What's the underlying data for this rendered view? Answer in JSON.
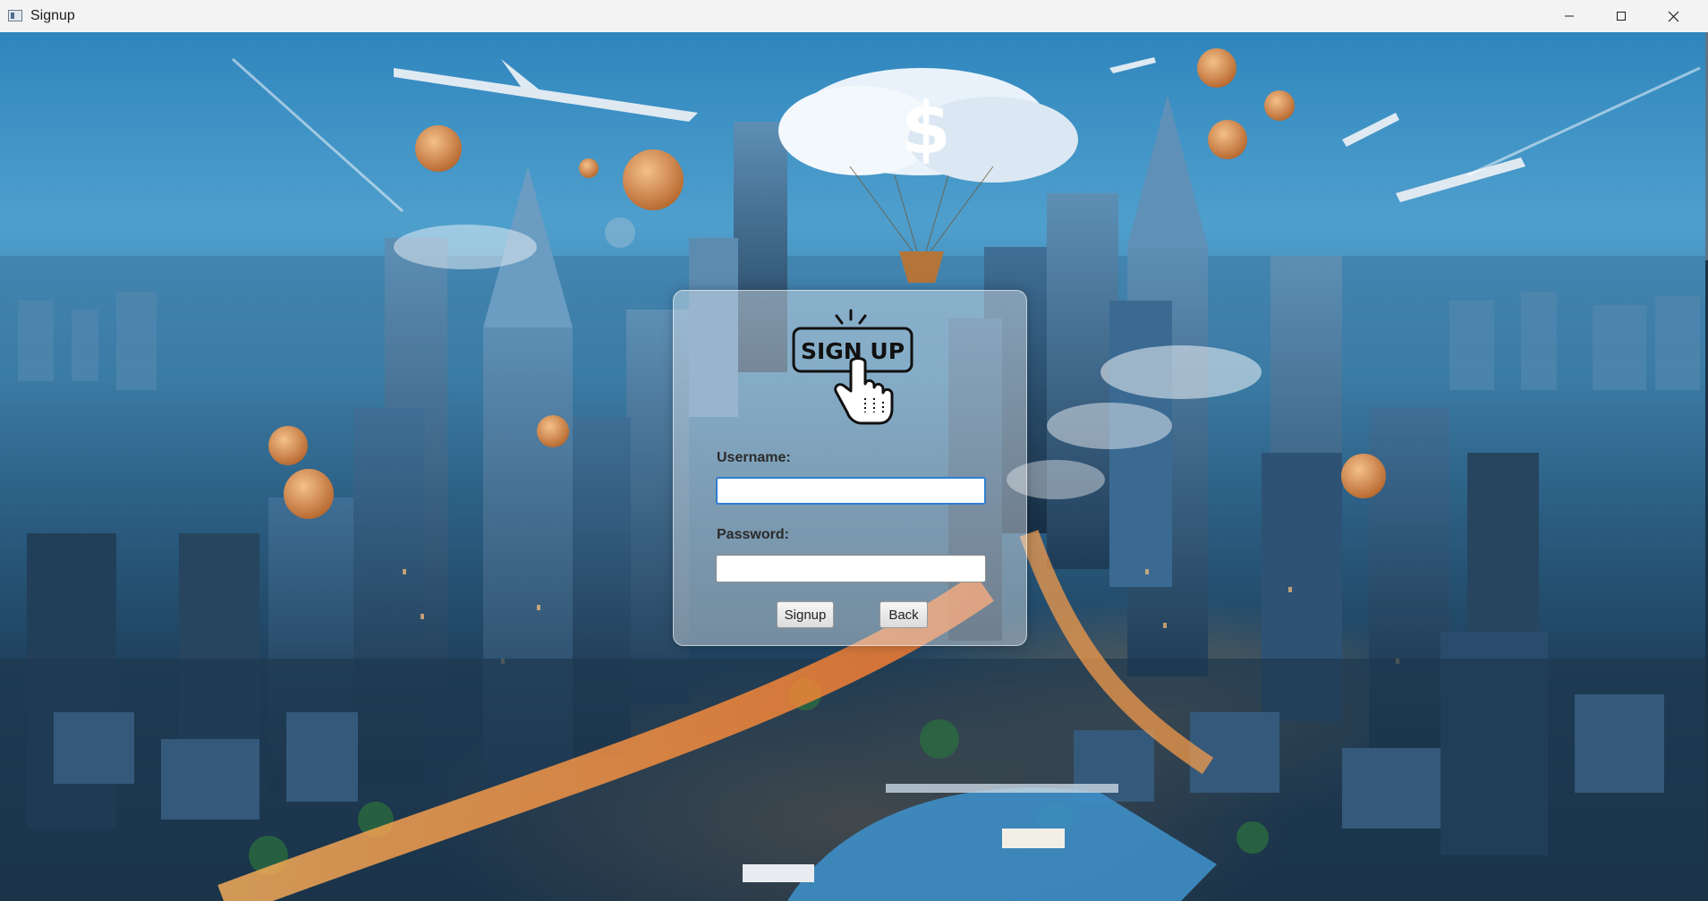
{
  "window": {
    "title": "Signup",
    "controls": {
      "minimize": "minimize-icon",
      "maximize": "maximize-icon",
      "close": "close-icon"
    }
  },
  "form": {
    "logo_text": "SIGN UP",
    "username_label": "Username:",
    "username_value": "",
    "password_label": "Password:",
    "password_value": "",
    "signup_label": "Signup",
    "back_label": "Back"
  },
  "colors": {
    "titlebar": "#f3f3f3",
    "focus_border": "#2e7fd0",
    "panel": "rgba(235,240,246,0.42)"
  }
}
